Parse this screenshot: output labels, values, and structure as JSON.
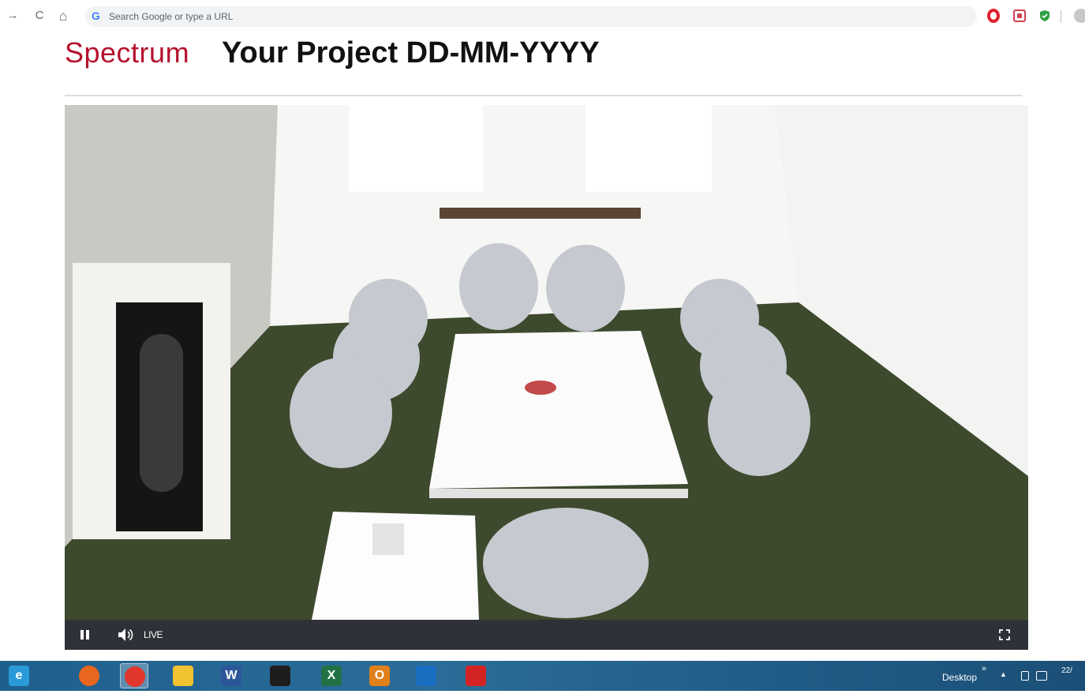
{
  "browser": {
    "nav": {
      "forward_glyph": "→",
      "reload_glyph": "C",
      "home_glyph": "⌂"
    },
    "omnibox": {
      "engine_icon": "google-g-icon",
      "placeholder": "Search Google or type a URL"
    },
    "extensions": [
      "opera-icon",
      "pocket-icon",
      "shield-icon"
    ]
  },
  "page": {
    "brand": "Spectrum",
    "title": "Your Project DD-MM-YYYY"
  },
  "player": {
    "stream_state": "LIVE",
    "content": "meeting-room-live-camera-feed",
    "controls": [
      "pause-icon",
      "volume-icon",
      "fullscreen-icon"
    ]
  },
  "taskbar": {
    "apps": [
      {
        "name": "internet-explorer",
        "glyph": "e",
        "color": "#2a9ad8"
      },
      {
        "name": "firefox",
        "glyph": "",
        "color": "#e8661d"
      },
      {
        "name": "chrome",
        "glyph": "",
        "color": "#e1372c",
        "active": true
      },
      {
        "name": "file-explorer",
        "glyph": "",
        "color": "#f1c232"
      },
      {
        "name": "word",
        "glyph": "W",
        "color": "#2b579a"
      },
      {
        "name": "speedometer-app",
        "glyph": "",
        "color": "#1d1d1d"
      },
      {
        "name": "excel",
        "glyph": "X",
        "color": "#207245"
      },
      {
        "name": "outlook",
        "glyph": "O",
        "color": "#e0801a"
      },
      {
        "name": "ink-app",
        "glyph": "",
        "color": "#1a6ec2"
      },
      {
        "name": "acrobat",
        "glyph": "",
        "color": "#d42323"
      }
    ],
    "desktop_label": "Desktop",
    "chevron": "»",
    "clock_partial": "22/"
  }
}
